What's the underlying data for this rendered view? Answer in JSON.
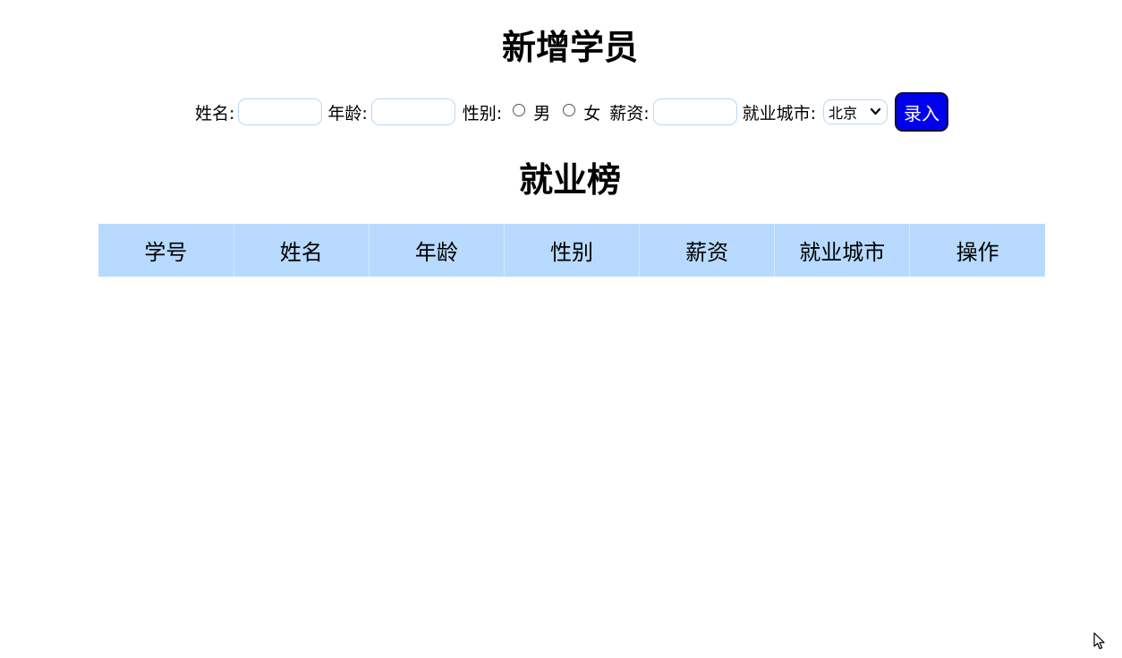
{
  "form": {
    "title": "新增学员",
    "name_label": "姓名:",
    "name_value": "",
    "age_label": "年龄:",
    "age_value": "",
    "gender_label": "性别:",
    "gender_options": [
      "男",
      "女"
    ],
    "salary_label": "薪资:",
    "salary_value": "",
    "city_label": "就业城市:",
    "city_selected": "北京",
    "submit_label": "录入"
  },
  "table": {
    "title": "就业榜",
    "headers": [
      "学号",
      "姓名",
      "年龄",
      "性别",
      "薪资",
      "就业城市",
      "操作"
    ]
  },
  "colors": {
    "header_bg": "#b8daff",
    "button_bg": "#0000ee",
    "input_border": "#b9d8f7"
  },
  "icons": {
    "select_arrow": "chevron-down-icon",
    "cursor": "mouse-cursor-icon"
  }
}
